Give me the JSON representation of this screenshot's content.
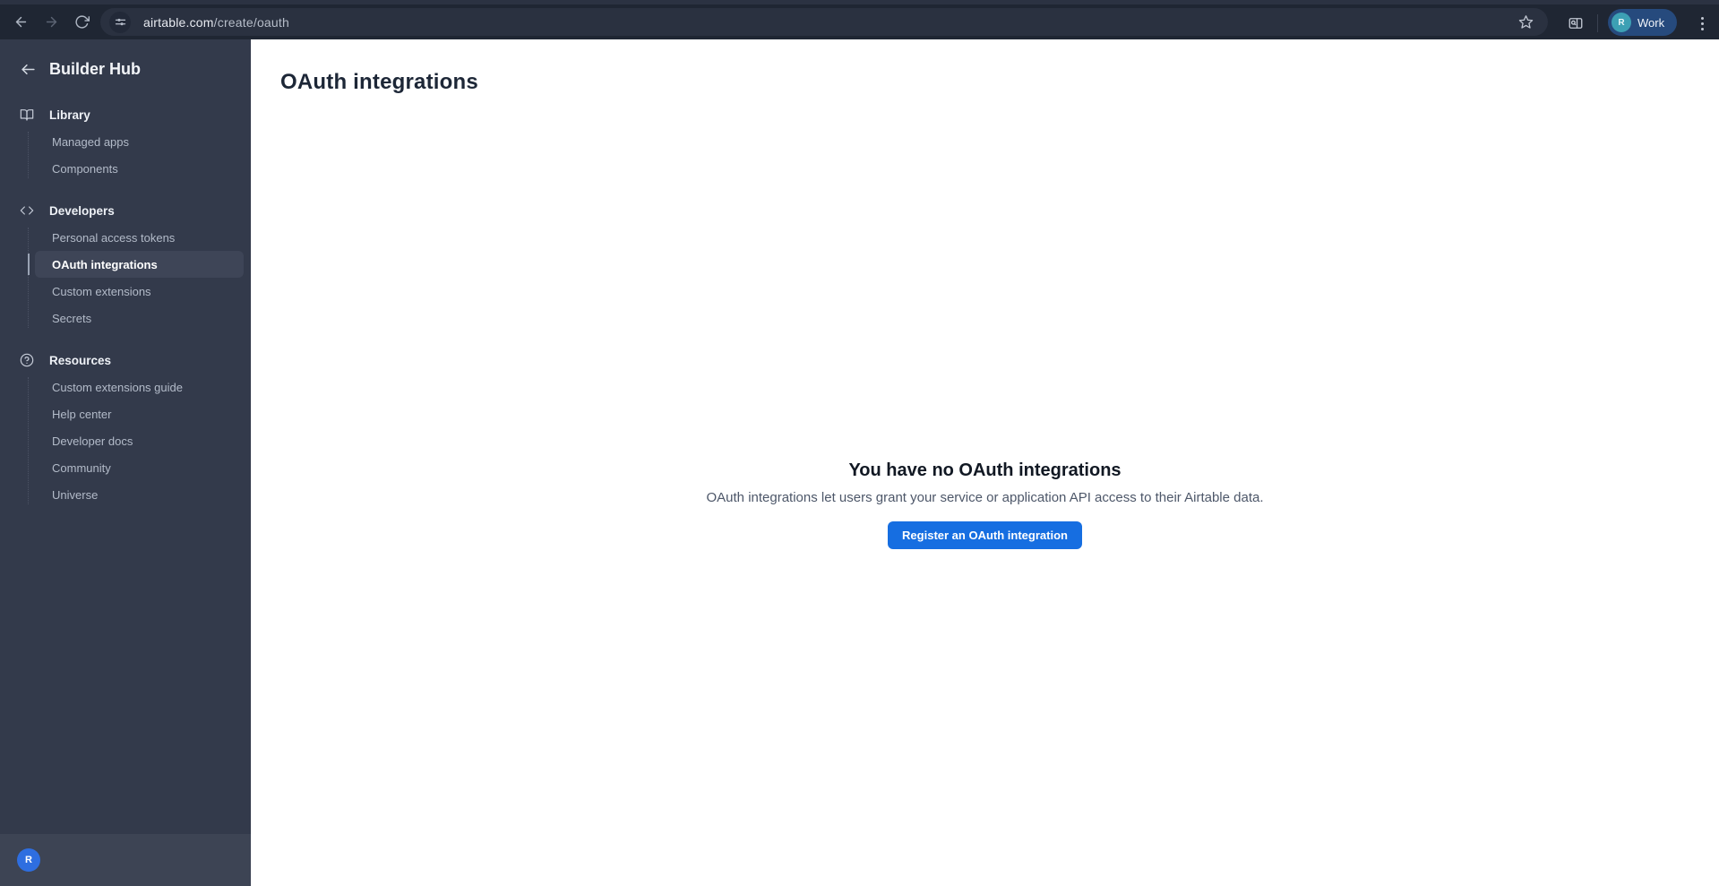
{
  "browser": {
    "url_domain": "airtable.com",
    "url_path": "/create/oauth",
    "profile": {
      "label": "Work",
      "avatar_initial": "R"
    },
    "icons": [
      "back-arrow",
      "forward-arrow",
      "refresh",
      "tune",
      "bookmark-star",
      "side-panel-search",
      "kebab-menu"
    ]
  },
  "sidebar": {
    "title": "Builder Hub",
    "back_icon": "arrow-left",
    "sections": [
      {
        "label": "Library",
        "icon": "book-open",
        "items": [
          {
            "label": "Managed apps"
          },
          {
            "label": "Components"
          }
        ]
      },
      {
        "label": "Developers",
        "icon": "code",
        "items": [
          {
            "label": "Personal access tokens"
          },
          {
            "label": "OAuth integrations",
            "active": true
          },
          {
            "label": "Custom extensions"
          },
          {
            "label": "Secrets"
          }
        ]
      },
      {
        "label": "Resources",
        "icon": "help-circle",
        "items": [
          {
            "label": "Custom extensions guide"
          },
          {
            "label": "Help center"
          },
          {
            "label": "Developer docs"
          },
          {
            "label": "Community"
          },
          {
            "label": "Universe"
          }
        ]
      }
    ],
    "footer": {
      "avatar_initial": "R"
    }
  },
  "main": {
    "title": "OAuth integrations",
    "empty_state": {
      "heading": "You have no OAuth integrations",
      "description": "OAuth integrations let users grant your service or application API access to their Airtable data.",
      "cta_label": "Register an OAuth integration"
    }
  },
  "colors": {
    "accent_blue": "#166ee1",
    "sidebar_bg": "#333a4b",
    "sidebar_footer_bg": "#3d4454",
    "sidebar_active_bg": "#3e4557",
    "toolbar_bg": "#1f2633",
    "omnibox_bg": "#2a3140",
    "profile_chip_bg": "#264a7d",
    "profile_avatar_teal": "#3da0b4",
    "footer_avatar_blue": "#2e6ee0"
  }
}
